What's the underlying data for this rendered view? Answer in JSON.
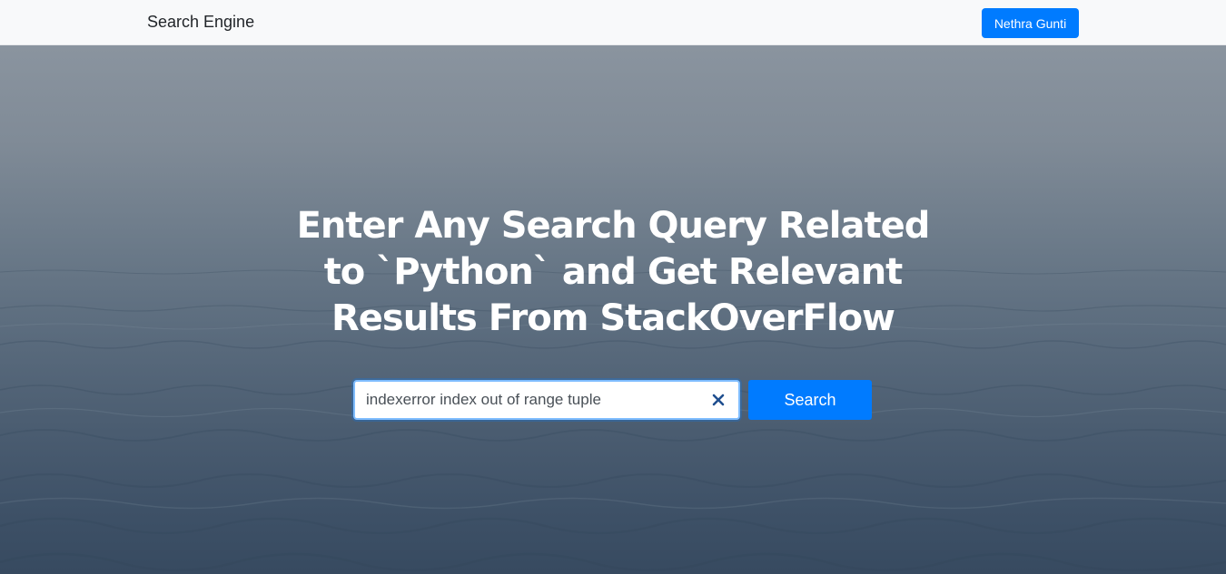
{
  "navbar": {
    "brand": "Search Engine",
    "user_button_label": "Nethra Gunti",
    "background_color": "#f8f9fa",
    "button_color": "#007bff"
  },
  "hero": {
    "headline": "Enter Any Search Query Related to `Python` and Get Relevant Results From StackOverFlow",
    "search": {
      "value": "indexerror index out of range tuple",
      "clear_icon": "close-icon"
    },
    "search_button_label": "Search",
    "accent_color": "#007bff"
  }
}
